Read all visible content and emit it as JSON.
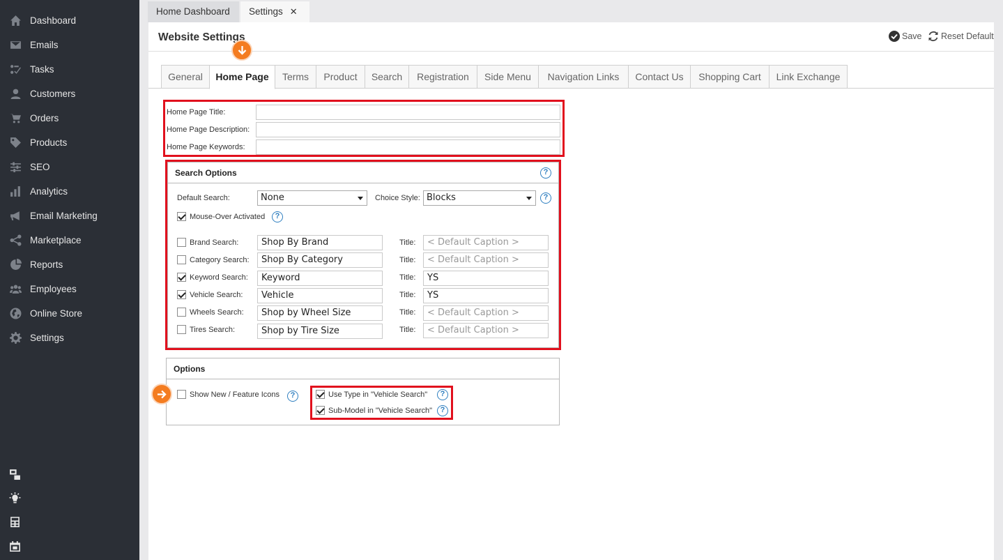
{
  "sidebar": {
    "items": [
      {
        "label": "Dashboard",
        "icon": "home-icon"
      },
      {
        "label": "Emails",
        "icon": "envelope-icon"
      },
      {
        "label": "Tasks",
        "icon": "tasks-icon"
      },
      {
        "label": "Customers",
        "icon": "user-icon"
      },
      {
        "label": "Orders",
        "icon": "cart-icon"
      },
      {
        "label": "Products",
        "icon": "tag-icon"
      },
      {
        "label": "SEO",
        "icon": "sliders-icon"
      },
      {
        "label": "Analytics",
        "icon": "bar-chart-icon"
      },
      {
        "label": "Email Marketing",
        "icon": "megaphone-icon"
      },
      {
        "label": "Marketplace",
        "icon": "share-icon"
      },
      {
        "label": "Reports",
        "icon": "pie-chart-icon"
      },
      {
        "label": "Employees",
        "icon": "users-icon"
      },
      {
        "label": "Online Store",
        "icon": "globe-icon"
      },
      {
        "label": "Settings",
        "icon": "gear-icon"
      }
    ],
    "tools": [
      "windows-icon",
      "lightbulb-icon",
      "calculator-icon",
      "calendar-icon"
    ]
  },
  "window_tabs": {
    "inactive": "Home Dashboard",
    "active": "Settings",
    "close": "✕"
  },
  "header": {
    "title": "Website Settings",
    "save": "Save",
    "reset": "Reset Default"
  },
  "subtabs": [
    "General",
    "Home Page",
    "Terms",
    "Product",
    "Search",
    "Registration",
    "Side Menu",
    "Navigation Links",
    "Contact Us",
    "Shopping Cart",
    "Link Exchange"
  ],
  "active_subtab": "Home Page",
  "home_page": {
    "title_label": "Home Page Title:",
    "title_value": "",
    "description_label": "Home Page Description:",
    "description_value": "",
    "keywords_label": "Home Page Keywords:",
    "keywords_value": ""
  },
  "search_options": {
    "heading": "Search Options",
    "help": "?",
    "default_search_label": "Default Search:",
    "default_search_value": "None",
    "choice_style_label": "Choice Style:",
    "choice_style_value": "Blocks",
    "mouse_over_label": "Mouse-Over Activated",
    "mouse_over_checked": true,
    "title_label": "Title:",
    "rows": [
      {
        "label": "Brand Search:",
        "checked": false,
        "caption": "Shop By Brand",
        "title": "< Default Caption >",
        "title_is_placeholder": true
      },
      {
        "label": "Category Search:",
        "checked": false,
        "caption": "Shop By Category",
        "title": "< Default Caption >",
        "title_is_placeholder": true
      },
      {
        "label": "Keyword Search:",
        "checked": true,
        "caption": "Keyword",
        "title": "YS",
        "title_is_placeholder": false
      },
      {
        "label": "Vehicle Search:",
        "checked": true,
        "caption": "Vehicle",
        "title": "YS",
        "title_is_placeholder": false
      },
      {
        "label": "Wheels Search:",
        "checked": false,
        "caption": "Shop by Wheel Size",
        "title": "< Default Caption >",
        "title_is_placeholder": true
      },
      {
        "label": "Tires Search:",
        "checked": false,
        "caption": "Shop by Tire Size",
        "title": "< Default Caption >",
        "title_is_placeholder": true
      }
    ]
  },
  "options": {
    "heading": "Options",
    "show_new_label": "Show New / Feature Icons",
    "show_new_checked": false,
    "use_type_label": "Use Type in \"Vehicle Search\"",
    "use_type_checked": true,
    "sub_model_label": "Sub-Model in \"Vehicle Search\"",
    "sub_model_checked": true
  },
  "colors": {
    "sidebar_bg": "#2b2f36",
    "highlight": "#e1101d",
    "badge": "#f47c20",
    "help": "#2f7fc0"
  }
}
